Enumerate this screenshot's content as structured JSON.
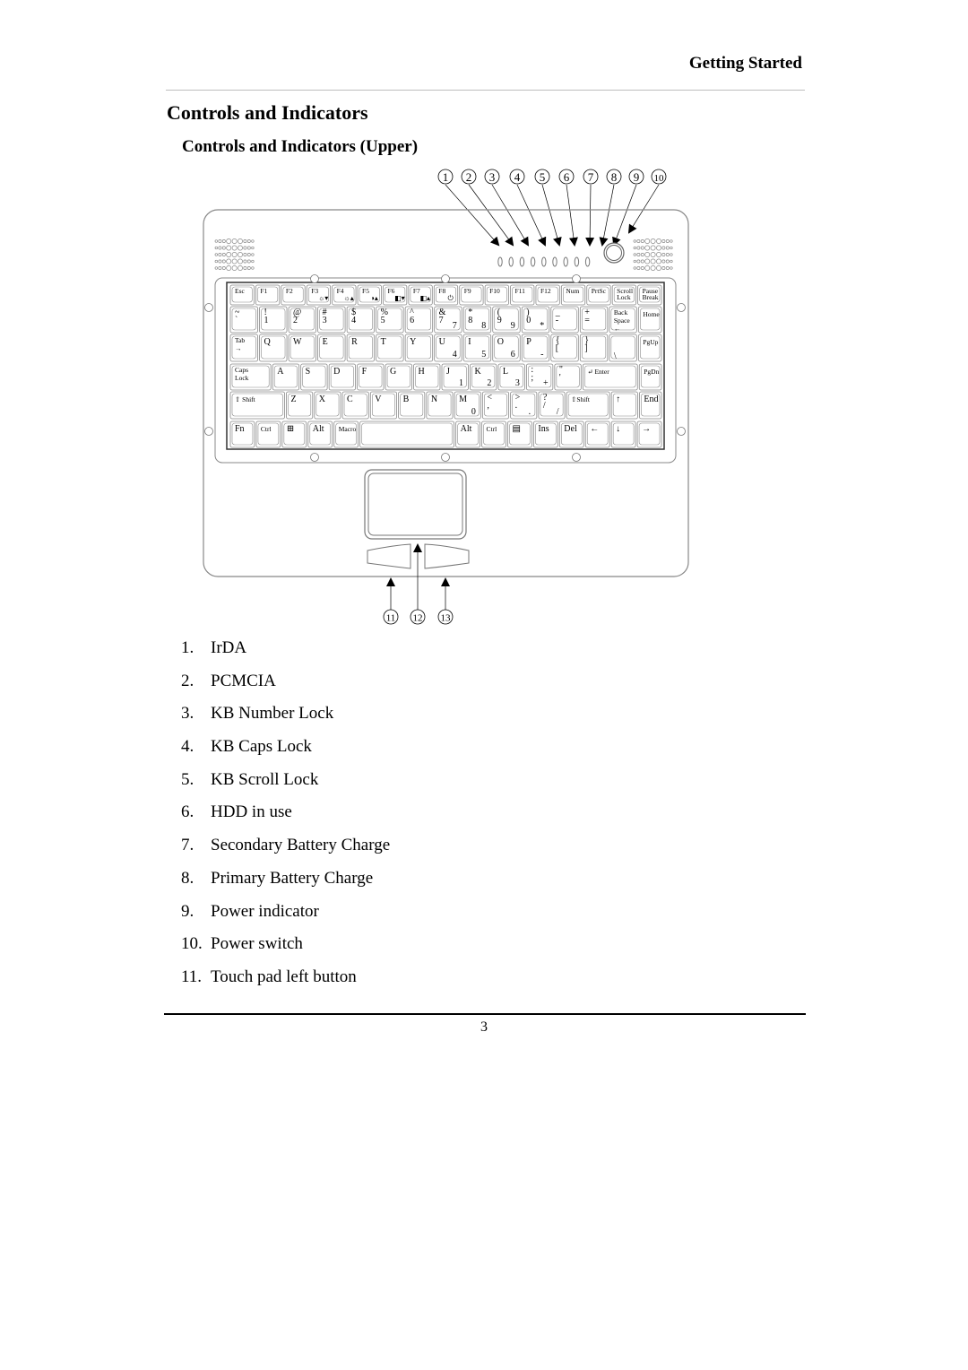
{
  "header": {
    "running_title": "Getting Started"
  },
  "section_title": "Controls and Indicators",
  "subsection_title": "Controls and Indicators (Upper)",
  "diagram": {
    "top_callouts": [
      "1",
      "2",
      "3",
      "4",
      "5",
      "6",
      "7",
      "8",
      "9",
      "10"
    ],
    "bottom_callouts": [
      "11",
      "12",
      "13"
    ],
    "keyboard_rows": [
      [
        [
          "Esc",
          ""
        ],
        [
          "F1",
          ""
        ],
        [
          "F2",
          ""
        ],
        [
          "F3",
          "☼▾"
        ],
        [
          "F4",
          "☼▴"
        ],
        [
          "F5",
          "◑▴"
        ],
        [
          "F6",
          "◧▾"
        ],
        [
          "F7",
          "◧▴"
        ],
        [
          "F8",
          "⏻"
        ],
        [
          "F9",
          ""
        ],
        [
          "F10",
          ""
        ],
        [
          "F11",
          ""
        ],
        [
          "F12",
          ""
        ],
        [
          "Num",
          ""
        ],
        [
          "PrtSc",
          ""
        ],
        [
          "Scroll|Lock",
          ""
        ],
        [
          "Pause|Break",
          ""
        ]
      ],
      [
        [
          "~|`",
          ""
        ],
        [
          "!|1",
          ""
        ],
        [
          "@|2",
          ""
        ],
        [
          "#|3",
          ""
        ],
        [
          "$|4",
          ""
        ],
        [
          "%|5",
          ""
        ],
        [
          "^|6",
          ""
        ],
        [
          "&|7",
          "7"
        ],
        [
          "*|8",
          "8"
        ],
        [
          "(|9",
          "9"
        ],
        [
          ")|0",
          "*"
        ],
        [
          "_|-",
          ""
        ],
        [
          "+|=",
          ""
        ],
        [
          "Back|Space|←",
          ""
        ],
        [
          "Home",
          ""
        ]
      ],
      [
        [
          "Tab|→",
          ""
        ],
        [
          "Q",
          ""
        ],
        [
          "W",
          ""
        ],
        [
          "E",
          ""
        ],
        [
          "R",
          ""
        ],
        [
          "T",
          ""
        ],
        [
          "Y",
          ""
        ],
        [
          "U",
          "4"
        ],
        [
          "I",
          "5"
        ],
        [
          "O",
          "6"
        ],
        [
          "P",
          "-"
        ],
        [
          "{|[",
          ""
        ],
        [
          "}|]",
          ""
        ],
        [
          "| |\\",
          ""
        ],
        [
          "PgUp",
          ""
        ]
      ],
      [
        [
          "Caps|Lock",
          ""
        ],
        [
          "A",
          ""
        ],
        [
          "S",
          ""
        ],
        [
          "D",
          ""
        ],
        [
          "F",
          ""
        ],
        [
          "G",
          ""
        ],
        [
          "H",
          ""
        ],
        [
          "J",
          "1"
        ],
        [
          "K",
          "2"
        ],
        [
          "L",
          "3"
        ],
        [
          ":|;",
          "+"
        ],
        [
          "\"|'",
          ""
        ],
        [
          "↵ Enter",
          ""
        ],
        [
          "PgDn",
          ""
        ]
      ],
      [
        [
          "⇧ Shift",
          ""
        ],
        [
          "Z",
          ""
        ],
        [
          "X",
          ""
        ],
        [
          "C",
          ""
        ],
        [
          "V",
          ""
        ],
        [
          "B",
          ""
        ],
        [
          "N",
          ""
        ],
        [
          "M",
          "0"
        ],
        [
          "<|,",
          ""
        ],
        [
          ">|.",
          "."
        ],
        [
          "?|/",
          "/"
        ],
        [
          "⇧Shift",
          ""
        ],
        [
          "↑",
          ""
        ],
        [
          "End",
          ""
        ]
      ],
      [
        [
          "Fn",
          ""
        ],
        [
          "Ctrl",
          ""
        ],
        [
          "⊞",
          ""
        ],
        [
          "Alt",
          ""
        ],
        [
          "Macro",
          ""
        ],
        [
          "",
          ""
        ],
        [
          "Alt",
          ""
        ],
        [
          "Ctrl",
          ""
        ],
        [
          "▤",
          ""
        ],
        [
          "Ins",
          ""
        ],
        [
          "Del",
          ""
        ],
        [
          "←",
          ""
        ],
        [
          "↓",
          ""
        ],
        [
          "→",
          ""
        ]
      ]
    ]
  },
  "legend": [
    {
      "num": "1.",
      "label": "IrDA"
    },
    {
      "num": "2.",
      "label": "PCMCIA"
    },
    {
      "num": "3.",
      "label": "KB Number Lock"
    },
    {
      "num": "4.",
      "label": "KB Caps Lock"
    },
    {
      "num": "5.",
      "label": "KB Scroll Lock"
    },
    {
      "num": "6.",
      "label": "HDD in use"
    },
    {
      "num": "7.",
      "label": "Secondary Battery Charge"
    },
    {
      "num": "8.",
      "label": "Primary Battery Charge"
    },
    {
      "num": "9.",
      "label": "Power indicator"
    },
    {
      "num": "10.",
      "label": "Power switch"
    },
    {
      "num": "11.",
      "label": "Touch pad left button"
    }
  ],
  "footer": {
    "page_number": "3"
  }
}
